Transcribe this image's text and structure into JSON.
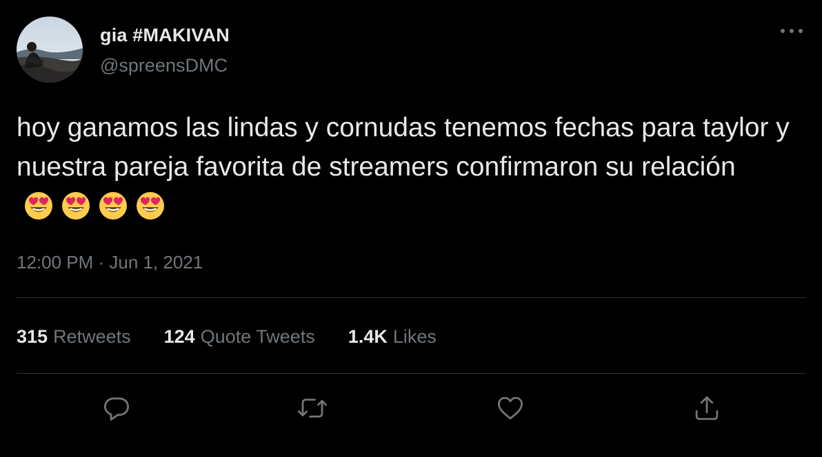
{
  "author": {
    "display_name": "gia #MAKIVAN",
    "handle": "@spreensDMC"
  },
  "tweet": {
    "text": "hoy ganamos las lindas y cornudas tenemos fechas para taylor y nuestra pareja favorita de streamers confirmaron su relación",
    "emojis": [
      "😍",
      "😍",
      "😍",
      "😍"
    ],
    "timestamp": "12:00 PM · Jun 1, 2021"
  },
  "stats": [
    {
      "value": "315",
      "label": "Retweets"
    },
    {
      "value": "124",
      "label": "Quote Tweets"
    },
    {
      "value": "1.4K",
      "label": "Likes"
    }
  ],
  "actions": [
    "reply-icon",
    "retweet-icon",
    "like-icon",
    "share-icon"
  ],
  "colors": {
    "background": "#000000",
    "primary_text": "#e7e9ea",
    "secondary_text": "#71767b",
    "divider": "#2f3336"
  }
}
